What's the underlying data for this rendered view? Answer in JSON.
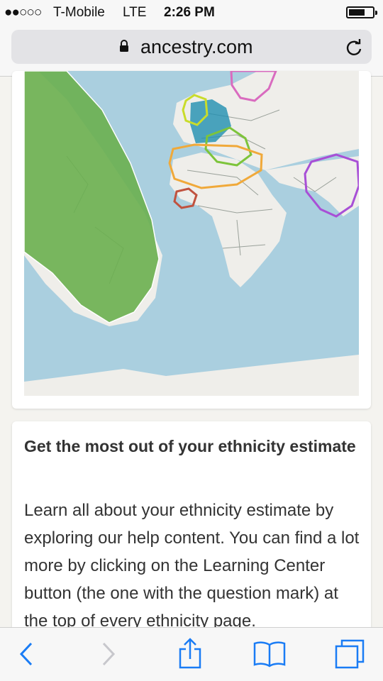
{
  "status_bar": {
    "signal": "●●○○○",
    "carrier": "T-Mobile",
    "network": "LTE",
    "time": "2:26 PM"
  },
  "browser": {
    "domain": "ancestry.com",
    "icons": {
      "lock": "lock-icon",
      "reload": "reload-icon"
    }
  },
  "map": {
    "regions": [
      {
        "name": "americas",
        "color": "#6aaf4f",
        "style": "filled"
      },
      {
        "name": "scandinavia",
        "color": "#d96bbf",
        "style": "outline"
      },
      {
        "name": "ireland-scotland",
        "color": "#c9dc2b",
        "style": "outline"
      },
      {
        "name": "great-britain",
        "color": "#1f8fb0",
        "style": "filled"
      },
      {
        "name": "europe-south",
        "color": "#7dc43b",
        "style": "outline"
      },
      {
        "name": "north-africa",
        "color": "#f0a93a",
        "style": "outline"
      },
      {
        "name": "asia-south",
        "color": "#a84fd6",
        "style": "outline"
      },
      {
        "name": "africa-west",
        "color": "#c0523f",
        "style": "outline"
      }
    ],
    "colors": {
      "ocean": "#aacfdf",
      "land": "#efeeea",
      "border": "#9aa19a"
    }
  },
  "info_card": {
    "heading": "Get the most out of your ethnicity estimate",
    "body": "Learn all about your ethnicity estimate by exploring our help content. You can find a lot more by clicking on the Learning Center button (the one with the question mark) at the top of every ethnicity page."
  },
  "toolbar": {
    "buttons": [
      "back-icon",
      "forward-icon",
      "share-icon",
      "bookmarks-icon",
      "tabs-icon"
    ],
    "accent": "#1a7cf5"
  }
}
